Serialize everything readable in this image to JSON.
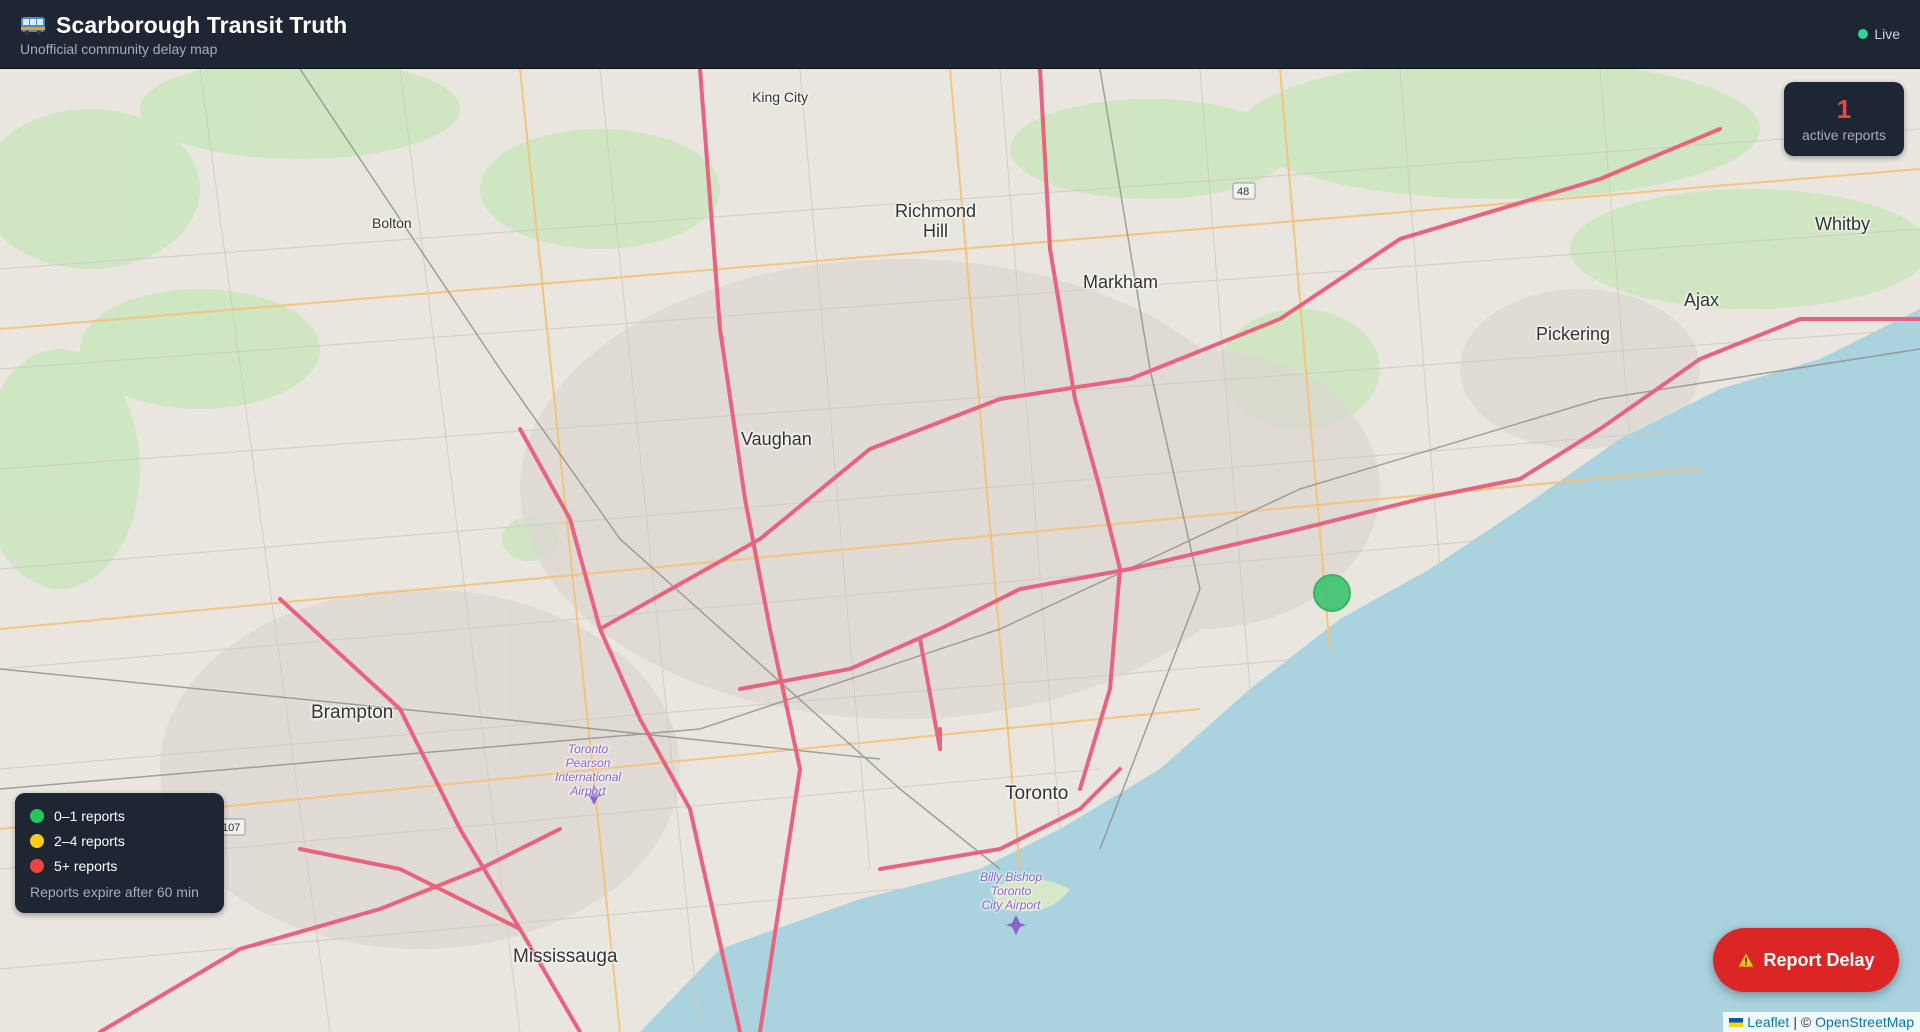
{
  "header": {
    "title": "Scarborough Transit Truth",
    "subtitle": "Unofficial community delay map",
    "live_label": "Live"
  },
  "counter": {
    "value": "1",
    "label": "active reports"
  },
  "legend": {
    "items": [
      {
        "label": "0–1 reports",
        "color": "#22c55e"
      },
      {
        "label": "2–4 reports",
        "color": "#facc15"
      },
      {
        "label": "5+ reports",
        "color": "#ef4444"
      }
    ],
    "note": "Reports expire after 60 min"
  },
  "report_button": {
    "label": "Report Delay"
  },
  "attribution": {
    "leaflet": "Leaflet",
    "separator": "| ©",
    "osm": "OpenStreetMap"
  },
  "map": {
    "places": [
      {
        "name": "King City"
      },
      {
        "name": "Richmond\nHill"
      },
      {
        "name": "Markham"
      },
      {
        "name": "Bolton"
      },
      {
        "name": "Vaughan"
      },
      {
        "name": "Pickering"
      },
      {
        "name": "Ajax"
      },
      {
        "name": "Whitby"
      },
      {
        "name": "Brampton"
      },
      {
        "name": "Toronto"
      },
      {
        "name": "Mississauga"
      },
      {
        "name": "Toronto\nPearson\nInternational\nAirport"
      },
      {
        "name": "Billy Bishop\nToronto\nCity Airport"
      }
    ],
    "markers": [
      {
        "reports": 1,
        "color": "#22c55e"
      }
    ]
  }
}
